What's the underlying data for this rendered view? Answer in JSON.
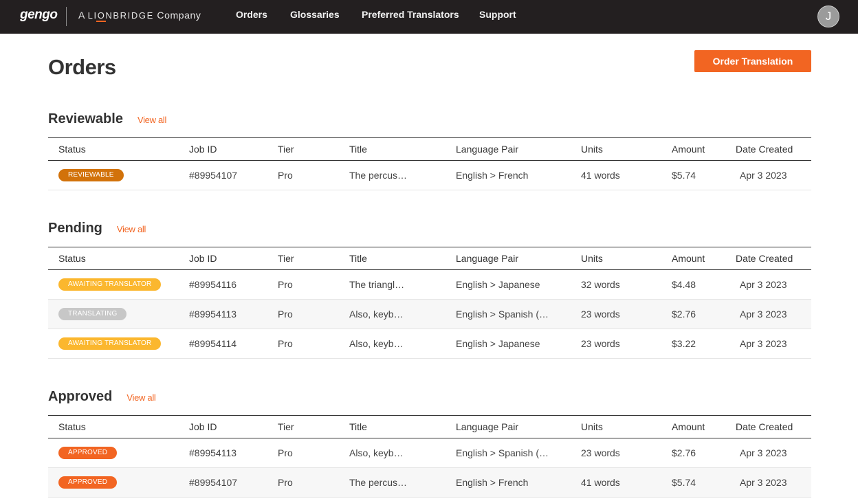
{
  "brand": {
    "logo": "gengo",
    "company_prefix": "A",
    "company_name": "LIONBRIDGE",
    "company_suffix": "Company"
  },
  "nav": {
    "orders": "Orders",
    "glossaries": "Glossaries",
    "preferred_translators": "Preferred Translators",
    "support": "Support"
  },
  "user": {
    "avatar_initial": "J"
  },
  "page": {
    "title": "Orders",
    "order_button": "Order Translation"
  },
  "colors": {
    "accent": "#f26522",
    "reviewable": "#d2720a",
    "awaiting": "#fbb72e",
    "translating": "#c7c7c7",
    "approved": "#f26522"
  },
  "columns": {
    "status": "Status",
    "job_id": "Job ID",
    "tier": "Tier",
    "title": "Title",
    "language_pair": "Language Pair",
    "units": "Units",
    "amount": "Amount",
    "date_created": "Date Created"
  },
  "sections": {
    "reviewable": {
      "title": "Reviewable",
      "view_all": "View all",
      "rows": [
        {
          "status": "REVIEWABLE",
          "job_id": "#89954107",
          "tier": "Pro",
          "title": "The percus…",
          "language_pair": "English > French",
          "units": "41 words",
          "amount": "$5.74",
          "date": "Apr 3 2023"
        }
      ]
    },
    "pending": {
      "title": "Pending",
      "view_all": "View all",
      "rows": [
        {
          "status": "AWAITING TRANSLATOR",
          "job_id": "#89954116",
          "tier": "Pro",
          "title": "The triangl…",
          "language_pair": "English > Japanese",
          "units": "32 words",
          "amount": "$4.48",
          "date": "Apr 3 2023"
        },
        {
          "status": "TRANSLATING",
          "job_id": "#89954113",
          "tier": "Pro",
          "title": "Also, keyb…",
          "language_pair": "English > Spanish (…",
          "units": "23 words",
          "amount": "$2.76",
          "date": "Apr 3 2023"
        },
        {
          "status": "AWAITING TRANSLATOR",
          "job_id": "#89954114",
          "tier": "Pro",
          "title": "Also, keyb…",
          "language_pair": "English > Japanese",
          "units": "23 words",
          "amount": "$3.22",
          "date": "Apr 3 2023"
        }
      ]
    },
    "approved": {
      "title": "Approved",
      "view_all": "View all",
      "rows": [
        {
          "status": "APPROVED",
          "job_id": "#89954113",
          "tier": "Pro",
          "title": "Also, keyb…",
          "language_pair": "English > Spanish (…",
          "units": "23 words",
          "amount": "$2.76",
          "date": "Apr 3 2023"
        },
        {
          "status": "APPROVED",
          "job_id": "#89954107",
          "tier": "Pro",
          "title": "The percus…",
          "language_pair": "English > French",
          "units": "41 words",
          "amount": "$5.74",
          "date": "Apr 3 2023"
        }
      ]
    }
  }
}
